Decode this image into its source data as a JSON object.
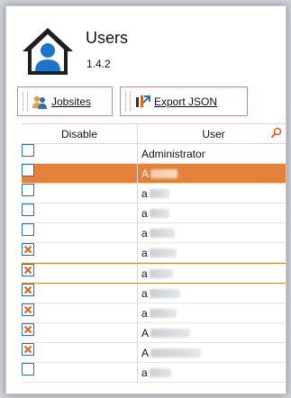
{
  "app": {
    "title": "Users",
    "version": "1.4.2"
  },
  "toolbar": {
    "jobsites_label": "Jobsites",
    "export_label": "Export JSON"
  },
  "grid": {
    "columns": [
      "Disable",
      "User"
    ],
    "rows": [
      {
        "user": "Administrator",
        "disabled": false,
        "selected": false
      },
      {
        "user": "A",
        "disabled": false,
        "selected": true
      },
      {
        "user": "a",
        "disabled": false,
        "selected": false
      },
      {
        "user": "a",
        "disabled": false,
        "selected": false
      },
      {
        "user": "a",
        "disabled": false,
        "selected": false
      },
      {
        "user": "a",
        "disabled": true,
        "selected": false
      },
      {
        "user": "a",
        "disabled": true,
        "selected": false,
        "current": true
      },
      {
        "user": "a",
        "disabled": true,
        "selected": false
      },
      {
        "user": "a",
        "disabled": true,
        "selected": false
      },
      {
        "user": "A",
        "disabled": true,
        "selected": false
      },
      {
        "user": "A",
        "disabled": true,
        "selected": false
      },
      {
        "user": "a",
        "disabled": false,
        "selected": false
      }
    ]
  },
  "colors": {
    "selection": "#e4813a",
    "accent": "#2e6fb4",
    "check_x": "#e0611c"
  },
  "icons": {
    "app": "users-house-icon",
    "jobsites": "users-icon",
    "export": "export-icon",
    "search": "search-icon"
  }
}
